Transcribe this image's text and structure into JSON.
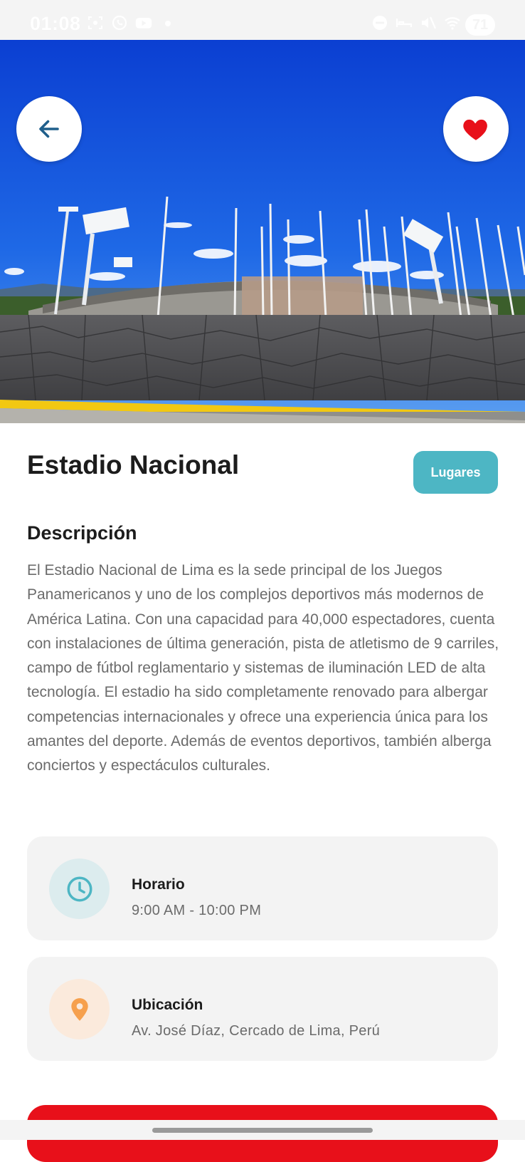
{
  "status_bar": {
    "time": "01:08",
    "battery": "71",
    "icons_left": [
      "screenshot-icon",
      "whatsapp-icon",
      "youtube-icon",
      "dot-icon"
    ],
    "icons_right": [
      "dnd-icon",
      "sleep-icon",
      "mute-icon",
      "wifi-icon",
      "signal-icon"
    ]
  },
  "hero": {
    "image": "stadium-photo",
    "back_icon": "arrow-left-icon",
    "favorite_icon": "heart-icon",
    "favorite_active": true
  },
  "place": {
    "title": "Estadio Nacional",
    "category": "Lugares",
    "description_heading": "Descripción",
    "description": "El Estadio Nacional de Lima es la sede principal de los Juegos Panamericanos y uno de los complejos deportivos más modernos de América Latina. Con una capacidad para 40,000 espectadores, cuenta con instalaciones de última generación, pista de atletismo de 9 carriles, campo de fútbol reglamentario y sistemas de iluminación LED de alta tecnología. El estadio ha sido completamente renovado para albergar competencias internacionales y ofrece una experiencia única para los amantes del deporte. Además de eventos deportivos, también alberga conciertos y espectáculos culturales."
  },
  "info": {
    "hours": {
      "label": "Horario",
      "value": "9:00 AM - 10:00 PM",
      "icon": "clock-icon",
      "color": "#4db6c4"
    },
    "location": {
      "label": "Ubicación",
      "value": "Av. José Díaz, Cercado de Lima, Perú",
      "icon": "location-pin-icon",
      "color": "#f6a04d"
    }
  },
  "colors": {
    "accent": "#4db6c4",
    "favorite": "#e8101a",
    "primary_button": "#e8101a",
    "back_arrow": "#1f5f8b"
  }
}
